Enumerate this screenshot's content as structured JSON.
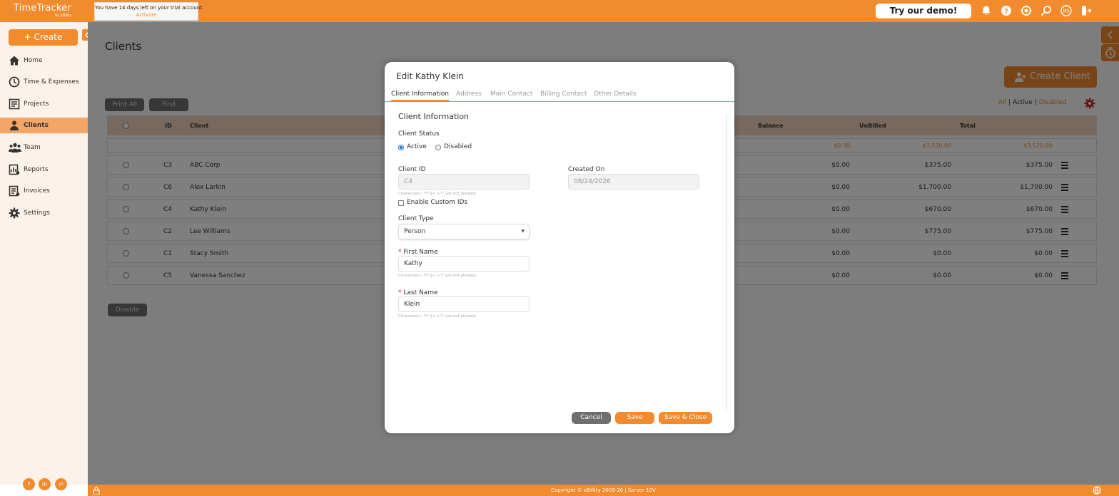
{
  "app": {
    "name": "TimeTracker",
    "by": "by eBility",
    "trial_message": "You have 14 days left on your trial account.",
    "trial_action": "Activate",
    "demo_label": "Try our demo!",
    "avatar_initials": "MS"
  },
  "sidebar": {
    "create_label": "+ Create",
    "items": [
      {
        "label": "Home",
        "icon": "home-icon"
      },
      {
        "label": "Time & Expenses",
        "icon": "clock-icon"
      },
      {
        "label": "Projects",
        "icon": "projects-icon"
      },
      {
        "label": "Clients",
        "icon": "client-icon",
        "active": true
      },
      {
        "label": "Team",
        "icon": "team-icon"
      },
      {
        "label": "Reports",
        "icon": "reports-icon"
      },
      {
        "label": "Invoices",
        "icon": "invoices-icon"
      },
      {
        "label": "Settings",
        "icon": "gear-icon"
      }
    ],
    "social": [
      "f",
      "in",
      "yt"
    ]
  },
  "page": {
    "title": "Clients",
    "create_client_label": "Create Client",
    "print_all_label": "Print All",
    "find_label": "Find",
    "filters": {
      "all": "All",
      "active": "Active",
      "disabled": "Disabled",
      "sep": "|"
    },
    "disable_label": "Disable"
  },
  "table": {
    "headers": {
      "id": "ID",
      "client": "Client",
      "balance": "Balance",
      "unbilled": "UnBilled",
      "total": "Total"
    },
    "totals": {
      "balance": "$0.00",
      "unbilled": "$3,520.00",
      "total": "$3,520.00"
    },
    "rows": [
      {
        "id": "C3",
        "client": "ABC Corp",
        "balance": "$0.00",
        "unbilled": "$375.00",
        "total": "$375.00"
      },
      {
        "id": "C6",
        "client": "Alex Larkin",
        "balance": "$0.00",
        "unbilled": "$1,700.00",
        "total": "$1,700.00"
      },
      {
        "id": "C4",
        "client": "Kathy Klein",
        "balance": "$0.00",
        "unbilled": "$670.00",
        "total": "$670.00"
      },
      {
        "id": "C2",
        "client": "Lee Williams",
        "balance": "$0.00",
        "unbilled": "$775.00",
        "total": "$775.00"
      },
      {
        "id": "C1",
        "client": "Stacy Smith",
        "balance": "$0.00",
        "unbilled": "$0.00",
        "total": "$0.00"
      },
      {
        "id": "C5",
        "client": "Vanessa Sanchez",
        "balance": "$0.00",
        "unbilled": "$0.00",
        "total": "$0.00"
      }
    ]
  },
  "footer": {
    "copyright": "Copyright © eBillity 2009-26 | Server 10V"
  },
  "modal": {
    "title": "Edit Kathy Klein",
    "tabs": [
      "Client Information",
      "Address",
      "Main Contact",
      "Billing Contact",
      "Other Details"
    ],
    "section_title": "Client Information",
    "status_label": "Client Status",
    "status_active": "Active",
    "status_disabled": "Disabled",
    "client_id_label": "Client ID",
    "client_id_value": "C4",
    "created_on_label": "Created On",
    "created_on_value": "08/24/2026",
    "chars_hint": "Characters / !*\\'\\|< >'\\\" are not allowed",
    "custom_ids_label": "Enable Custom IDs",
    "client_type_label": "Client Type",
    "client_type_value": "Person",
    "first_name_label": "First Name",
    "first_name_value": "Kathy",
    "last_name_label": "Last Name",
    "last_name_value": "Klein",
    "required_mark": "*",
    "cancel_label": "Cancel",
    "save_label": "Save",
    "save_close_label": "Save & Close"
  },
  "colors": {
    "accent": "#f28a2e",
    "sidebar_bg": "#fdf2e9",
    "radio_blue": "#2b73d6"
  }
}
